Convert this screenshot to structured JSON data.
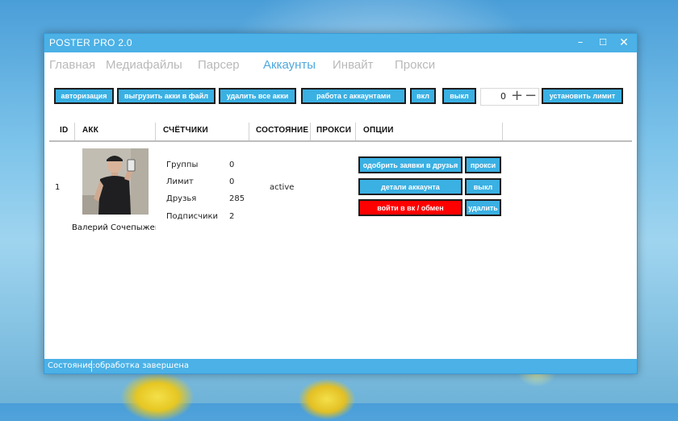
{
  "window": {
    "title": "POSTER PRO 2.0",
    "minimize_glyph": "–",
    "maximize_glyph": "☐",
    "close_glyph": "✕"
  },
  "nav": {
    "tabs": [
      {
        "label": "Главная",
        "active": false
      },
      {
        "label": "Медиафайлы",
        "active": false
      },
      {
        "label": "Парсер",
        "active": false
      },
      {
        "label": "Аккаунты",
        "active": true
      },
      {
        "label": "Инвайт",
        "active": false
      },
      {
        "label": "Прокси",
        "active": false
      }
    ]
  },
  "toolbar": {
    "authorize": "авторизация",
    "export": "выгрузить акки в файл",
    "delete_all": "удалить все акки",
    "work_accounts": "работа с аккаунтами",
    "on": "вкл",
    "off": "выкл",
    "limit_value": "0",
    "plus_glyph": "+",
    "minus_glyph": "−",
    "set_limit": "установить лимит"
  },
  "table": {
    "headers": [
      "ID",
      "АКК",
      "СЧЁТЧИКИ",
      "СОСТОЯНИЕ",
      "ПРОКСИ",
      "ОПЦИИ"
    ],
    "rows": [
      {
        "id": "1",
        "name": "Валерий Сочепыженко",
        "counters": [
          {
            "label": "Группы",
            "value": "0"
          },
          {
            "label": "Лимит",
            "value": "0"
          },
          {
            "label": "Друзья",
            "value": "285"
          },
          {
            "label": "Подписчики",
            "value": "2"
          }
        ],
        "state": "active",
        "options": {
          "approve_friends": "одобрить заявки в друзья",
          "proxy": "прокси",
          "account_details": "детали аккаунта",
          "off": "выкл",
          "login_vk": "войти в вк / обмен",
          "delete": "удалить"
        }
      }
    ]
  },
  "status": {
    "label": "Состояние:",
    "value": "обработка завершена"
  },
  "colors": {
    "accent": "#4bb1e6",
    "button": "#3ab0e3",
    "danger": "#ff0000",
    "active_tab": "#4ea8dc"
  }
}
